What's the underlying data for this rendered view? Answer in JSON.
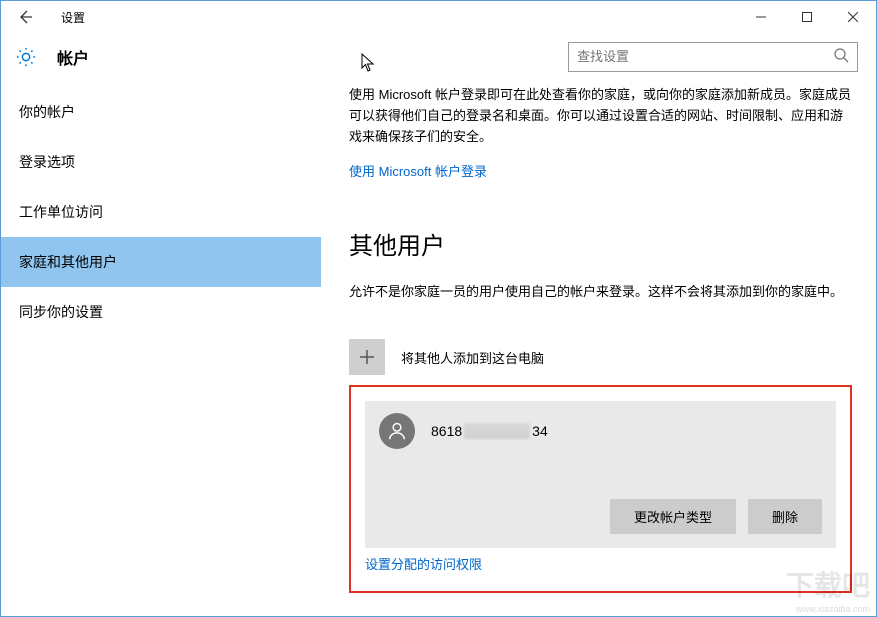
{
  "window": {
    "title": "设置"
  },
  "header": {
    "section": "帐户",
    "search_placeholder": "查找设置"
  },
  "sidebar": {
    "items": [
      {
        "label": "你的帐户"
      },
      {
        "label": "登录选项"
      },
      {
        "label": "工作单位访问"
      },
      {
        "label": "家庭和其他用户"
      },
      {
        "label": "同步你的设置"
      }
    ]
  },
  "main": {
    "family_desc": "使用 Microsoft 帐户登录即可在此处查看你的家庭，或向你的家庭添加新成员。家庭成员可以获得他们自己的登录名和桌面。你可以通过设置合适的网站、时间限制、应用和游戏来确保孩子们的安全。",
    "family_link": "使用 Microsoft 帐户登录",
    "other_users_heading": "其他用户",
    "other_users_desc": "允许不是你家庭一员的用户使用自己的帐户来登录。这样不会将其添加到你的家庭中。",
    "add_label": "将其他人添加到这台电脑",
    "user": {
      "name_prefix": "8618",
      "name_suffix": "34"
    },
    "change_type_btn": "更改帐户类型",
    "delete_btn": "删除",
    "assigned_access_link": "设置分配的访问权限"
  },
  "watermark": {
    "text": "下载吧",
    "url": "www.xiazaiba.com"
  }
}
